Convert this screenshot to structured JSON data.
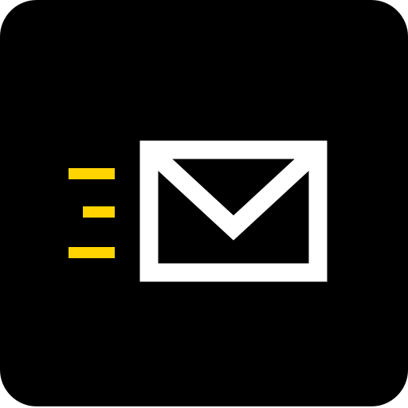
{
  "icon": {
    "name": "send-mail-app-icon",
    "glyph": "envelope-with-speed-lines",
    "colors": {
      "background": "#000000",
      "envelope": "#ffffff",
      "speed_lines": "#ffd400"
    }
  }
}
